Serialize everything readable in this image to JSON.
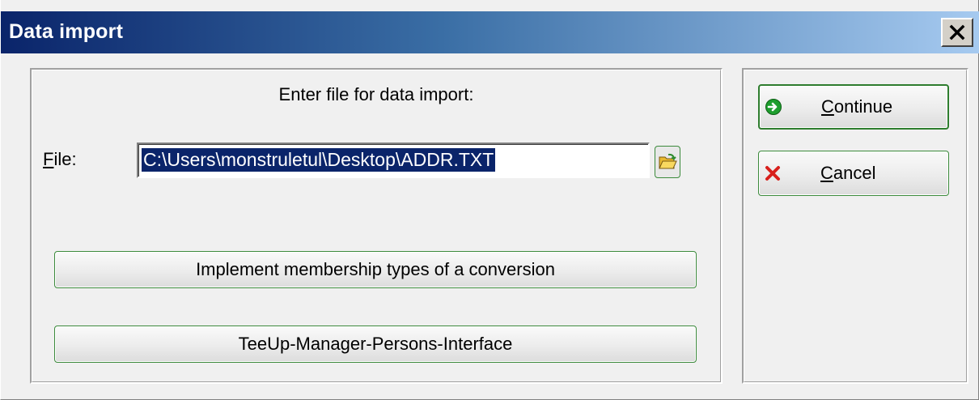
{
  "window": {
    "title": "Data import",
    "close_label": "×"
  },
  "form": {
    "prompt": "Enter file for data import:",
    "file_label_first": "F",
    "file_label_rest": "ile:",
    "file_value": "C:\\Users\\monstruletul\\Desktop\\ADDR.TXT"
  },
  "buttons": {
    "implement_label": "Implement membership types of a conversion",
    "teeup_label": "TeeUp-Manager-Persons-Interface",
    "continue_first": "C",
    "continue_rest": "ontinue",
    "cancel_first": "C",
    "cancel_rest": "ancel"
  },
  "icons": {
    "close": "close-icon",
    "browse": "folder-open-icon",
    "continue": "green-arrow-icon",
    "cancel": "red-x-icon"
  },
  "colors": {
    "title_gradient_start": "#0a246a",
    "title_gradient_end": "#a6caf0",
    "selection": "#0a246a",
    "button_border": "#3c8a3c"
  }
}
